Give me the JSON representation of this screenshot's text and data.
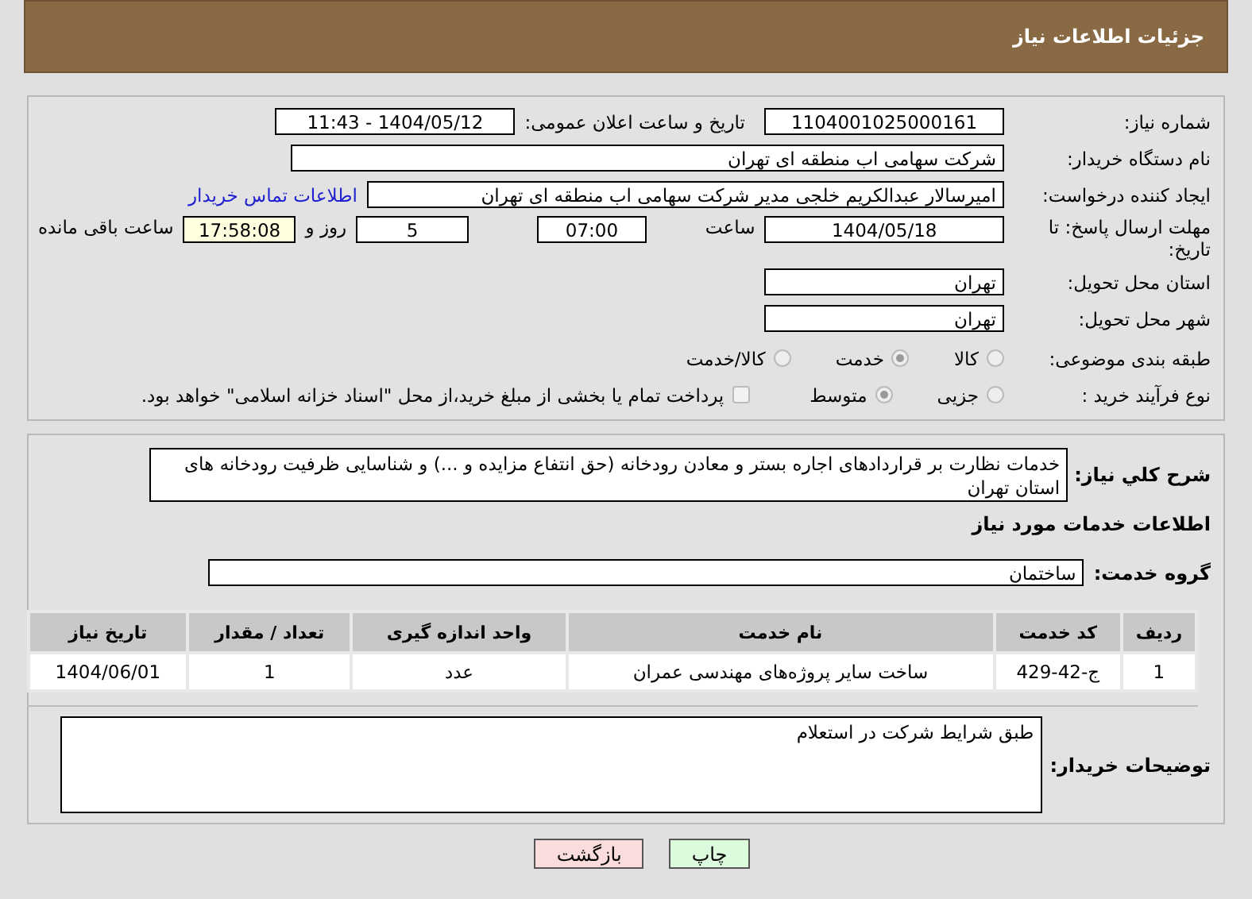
{
  "header": {
    "title": "جزئیات اطلاعات نیاز"
  },
  "need_info": {
    "need_number": {
      "label": "شماره نیاز:",
      "value": "1104001025000161"
    },
    "announce": {
      "label": "تاریخ و ساعت اعلان عمومی:",
      "value": "1404/05/12 - 11:43"
    },
    "buyer_org": {
      "label": "نام دستگاه خریدار:",
      "value": "شرکت سهامی اب منطقه ای تهران"
    },
    "requester": {
      "label": "ایجاد کننده درخواست:",
      "value": "امیرسالار عبدالکریم خلجی مدیر شرکت سهامی اب منطقه ای تهران",
      "link": "اطلاعات تماس خریدار"
    },
    "deadline": {
      "label": "مهلت ارسال پاسخ: تا تاریخ:",
      "date": "1404/05/18",
      "time_label": "ساعت",
      "time": "07:00",
      "days": "5",
      "days_label": "روز و",
      "remaining": "17:58:08",
      "remaining_label": "ساعت باقی مانده"
    },
    "province": {
      "label": "استان محل تحویل:",
      "value": "تهران"
    },
    "city": {
      "label": "شهر محل تحویل:",
      "value": "تهران"
    },
    "category": {
      "label": "طبقه بندی موضوعی:",
      "options": [
        {
          "label": "کالا",
          "selected": false
        },
        {
          "label": "خدمت",
          "selected": true
        },
        {
          "label": "کالا/خدمت",
          "selected": false
        }
      ]
    },
    "process": {
      "label": "نوع فرآیند خرید :",
      "options": [
        {
          "label": "جزیی",
          "selected": false
        },
        {
          "label": "متوسط",
          "selected": true
        }
      ],
      "payment": {
        "checked": false,
        "label": "پرداخت تمام یا بخشی از مبلغ خرید،از محل \"اسناد خزانه اسلامی\" خواهد بود."
      }
    }
  },
  "services": {
    "description": {
      "label": "شرح کلي نياز:",
      "value": "خدمات نظارت بر قراردادهای اجاره بستر و معادن رودخانه (حق انتفاع مزایده و ...) و شناسایی ظرفیت رودخانه های استان تهران"
    },
    "heading": "اطلاعات خدمات مورد نیاز",
    "group": {
      "label": "گروه خدمت:",
      "value": "ساختمان"
    },
    "table": {
      "columns": [
        "ردیف",
        "کد خدمت",
        "نام خدمت",
        "واحد اندازه گیری",
        "تعداد / مقدار",
        "تاریخ نیاز"
      ],
      "rows": [
        [
          "1",
          "ج-42-429",
          "ساخت سایر پروژه‌های مهندسی عمران",
          "عدد",
          "1",
          "1404/06/01"
        ]
      ]
    },
    "buyer_notes": {
      "label": "توضیحات خریدار:",
      "value": "طبق شرایط شرکت در استعلام"
    }
  },
  "buttons": [
    {
      "label": "چاپ",
      "kind": "print"
    },
    {
      "label": "بازگشت",
      "kind": "back"
    }
  ]
}
